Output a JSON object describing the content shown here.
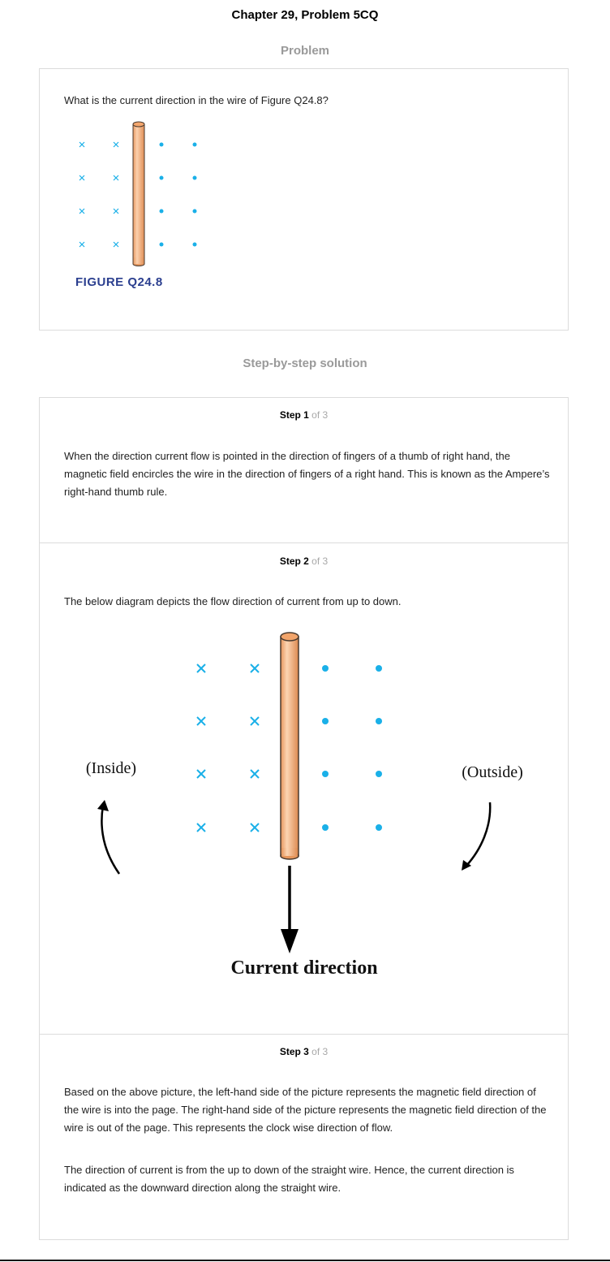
{
  "header": {
    "title": "Chapter 29, Problem 5CQ"
  },
  "problem_section": {
    "heading": "Problem",
    "question": "What is the current direction in the wire of Figure Q24.8?",
    "figure_caption": "FIGURE Q24.8"
  },
  "solution_section": {
    "heading": "Step-by-step solution",
    "steps": [
      {
        "label": "Step 1",
        "of": "of 3",
        "paragraphs": [
          "When the direction current flow is pointed in the direction of fingers of a thumb of right hand, the magnetic field encircles the wire in the direction of fingers of a right hand. This is known as the Ampere’s right-hand thumb rule."
        ]
      },
      {
        "label": "Step 2",
        "of": "of 3",
        "paragraphs": [
          "The below diagram depicts the flow direction of current from up to down."
        ],
        "diagram": {
          "inside_label": "(Inside)",
          "outside_label": "(Outside)",
          "current_label": "Current direction"
        }
      },
      {
        "label": "Step 3",
        "of": "of 3",
        "paragraphs": [
          "Based on the above picture, the left-hand side of the picture represents the magnetic field direction of the wire is into the page. The right-hand side of the picture represents the magnetic field direction of the wire is out of the page. This represents the clock wise direction of flow.",
          "The direction of current is from the up to down of the straight wire. Hence, the current direction is indicated as the downward direction along the straight wire."
        ]
      }
    ]
  },
  "colors": {
    "field_marker": "#1ab0e8",
    "wire_fill": "#f4b483",
    "wire_outline": "#4a3a2e",
    "caption": "#2b3f8f",
    "muted_text": "#9a9a9a"
  }
}
